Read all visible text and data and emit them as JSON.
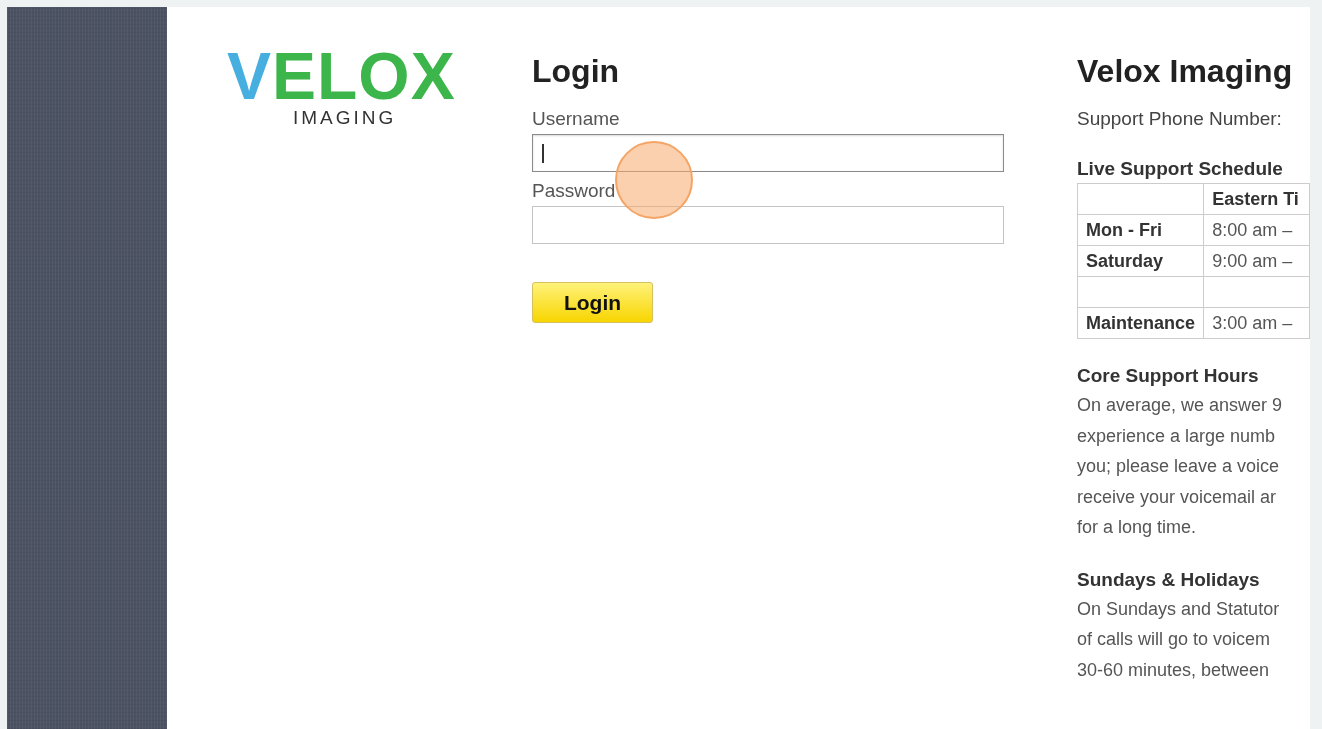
{
  "logo": {
    "wordmark": "VELOX",
    "subtitle": "IMAGING"
  },
  "login": {
    "title": "Login",
    "fields": [
      {
        "label": "Username",
        "focused": true
      },
      {
        "label": "Password",
        "focused": false
      }
    ],
    "button": "Login"
  },
  "info": {
    "title": "Velox Imaging",
    "phone_label": "Support Phone Number:",
    "schedule_title": "Live Support Schedule",
    "schedule_header": "Eastern Ti",
    "schedule_rows": [
      {
        "day": "Mon - Fri",
        "time": "8:00 am –"
      },
      {
        "day": "Saturday",
        "time": "9:00 am –"
      },
      {},
      {
        "day": "Maintenance",
        "time": "3:00 am –"
      }
    ],
    "sections": [
      {
        "title": "Core Support Hours",
        "lines": [
          "On average, we answer 9",
          "experience a large numb",
          "you; please leave a voice",
          "receive your voicemail ar",
          "for a long time."
        ]
      },
      {
        "title": "Sundays & Holidays",
        "lines": [
          "On Sundays and Statutor",
          "of calls will go to voicem",
          "30-60 minutes, between"
        ]
      }
    ]
  }
}
